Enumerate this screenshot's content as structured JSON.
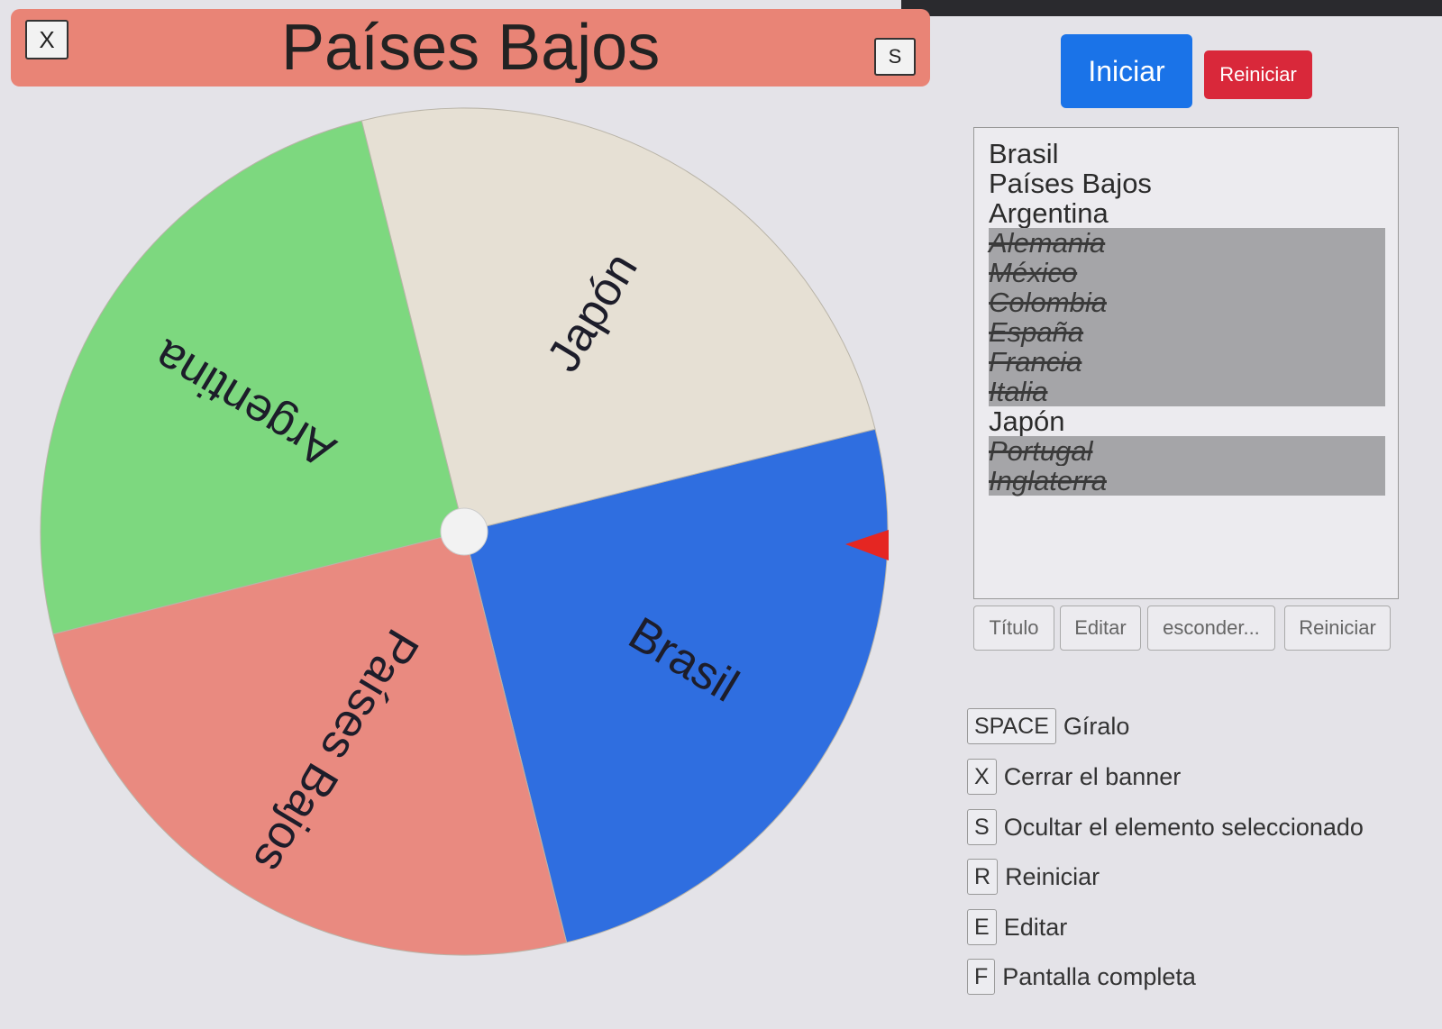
{
  "banner": {
    "close_label": "X",
    "title": "Países Bajos",
    "hide_label": "S",
    "background": "#e98476"
  },
  "controls": {
    "start_label": "Iniciar",
    "reset_label": "Reiniciar",
    "start_color": "#1a73e8",
    "reset_color": "#d9283a"
  },
  "wheel": {
    "segments": [
      {
        "label": "Brasil",
        "color": "#2f6ee0"
      },
      {
        "label": "Países Bajos",
        "color": "#e98a80"
      },
      {
        "label": "Argentina",
        "color": "#7dd87f"
      },
      {
        "label": "Japón",
        "color": "#e6e0d4"
      }
    ],
    "pointer_color": "#e52622"
  },
  "entries": [
    {
      "label": "Brasil",
      "hidden": false
    },
    {
      "label": "Países Bajos",
      "hidden": false
    },
    {
      "label": "Argentina",
      "hidden": false
    },
    {
      "label": "Alemania",
      "hidden": true
    },
    {
      "label": "México",
      "hidden": true
    },
    {
      "label": "Colombia",
      "hidden": true
    },
    {
      "label": "España",
      "hidden": true
    },
    {
      "label": "Francia",
      "hidden": true
    },
    {
      "label": "Italia",
      "hidden": true
    },
    {
      "label": "Japón",
      "hidden": false
    },
    {
      "label": "Portugal",
      "hidden": true
    },
    {
      "label": "Inglaterra",
      "hidden": true
    }
  ],
  "toolbar": {
    "title_label": "Título",
    "edit_label": "Editar",
    "hide_label": "esconder...",
    "reset_label": "Reiniciar"
  },
  "shortcuts": [
    {
      "key": "SPACE",
      "label": "Gíralo"
    },
    {
      "key": "X",
      "label": "Cerrar el banner"
    },
    {
      "key": "S",
      "label": "Ocultar el elemento seleccionado"
    },
    {
      "key": "R",
      "label": "Reiniciar"
    },
    {
      "key": "E",
      "label": "Editar"
    },
    {
      "key": "F",
      "label": "Pantalla completa"
    }
  ]
}
